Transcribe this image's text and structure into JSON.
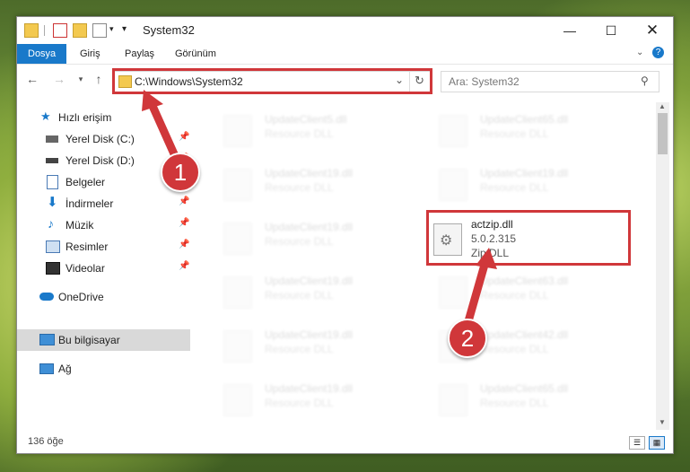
{
  "window": {
    "title": "System32"
  },
  "ribbon": {
    "tabs": [
      "Dosya",
      "Giriş",
      "Paylaş",
      "Görünüm"
    ]
  },
  "address": {
    "path": "C:\\Windows\\System32"
  },
  "search": {
    "placeholder": "Ara: System32"
  },
  "sidebar": {
    "items": [
      {
        "label": "Hızlı erişim",
        "icon": "star-icon",
        "pinned": false
      },
      {
        "label": "Yerel Disk (C:)",
        "icon": "drive-icon",
        "pinned": true
      },
      {
        "label": "Yerel Disk (D:)",
        "icon": "drive-icon",
        "pinned": true
      },
      {
        "label": "Belgeler",
        "icon": "document-icon",
        "pinned": true
      },
      {
        "label": "İndirmeler",
        "icon": "download-icon",
        "pinned": true
      },
      {
        "label": "Müzik",
        "icon": "music-icon",
        "pinned": true
      },
      {
        "label": "Resimler",
        "icon": "pictures-icon",
        "pinned": true
      },
      {
        "label": "Videolar",
        "icon": "video-icon",
        "pinned": true
      },
      {
        "label": "OneDrive",
        "icon": "cloud-icon",
        "pinned": false
      },
      {
        "label": "Bu bilgisayar",
        "icon": "computer-icon",
        "pinned": false,
        "selected": true
      },
      {
        "label": "Ağ",
        "icon": "network-icon",
        "pinned": false
      }
    ]
  },
  "files": [
    {
      "name": "UpdateClient5.dll",
      "type": "Resource DLL"
    },
    {
      "name": "UpdateClient65.dll",
      "type": "Resource DLL"
    },
    {
      "name": "UpdateClient19.dll",
      "type": "Resource DLL"
    },
    {
      "name": "UpdateClient19.dll",
      "type": "Resource DLL"
    },
    {
      "name": "UpdateClient19.dll",
      "type": "Resource DLL"
    },
    {
      "name": "actzip.dll",
      "version": "5.0.2.315",
      "type": "Zip DLL",
      "highlighted": true
    },
    {
      "name": "UpdateClient19.dll",
      "type": "Resource DLL"
    },
    {
      "name": "UpdateClient63.dll",
      "type": "Resource DLL"
    },
    {
      "name": "UpdateClient19.dll",
      "type": "Resource DLL"
    },
    {
      "name": "UpdateClient42.dll",
      "type": "Resource DLL"
    },
    {
      "name": "UpdateClient19.dll",
      "type": "Resource DLL"
    },
    {
      "name": "UpdateClient65.dll",
      "type": "Resource DLL"
    }
  ],
  "status": {
    "count": "136 öğe"
  },
  "annotations": {
    "step1": "1",
    "step2": "2",
    "color": "#d0373a"
  },
  "colors": {
    "accent": "#1979ca"
  }
}
